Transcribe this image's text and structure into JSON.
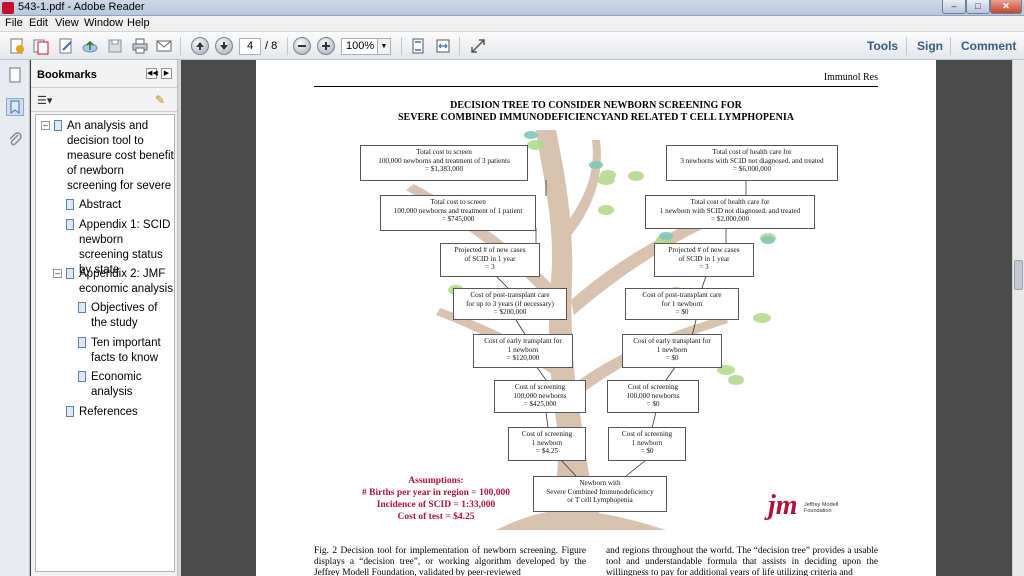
{
  "window": {
    "title": "543-1.pdf - Adobe Reader",
    "min_glyph": "–",
    "max_glyph": "□",
    "close_glyph": "✕"
  },
  "menu": [
    "File",
    "Edit",
    "View",
    "Window",
    "Help"
  ],
  "toolbar": {
    "page_number": "4",
    "page_total": "/ 8",
    "zoom": "100%",
    "tools_label": "Tools",
    "sign_label": "Sign",
    "comment_label": "Comment"
  },
  "bookmarks": {
    "title": "Bookmarks",
    "items": [
      {
        "label": "An analysis and decision tool to measure cost benefit of newborn screening for severe",
        "expanded": true
      },
      {
        "label": "Abstract"
      },
      {
        "label": "Appendix 1: SCID newborn screening status by state"
      },
      {
        "label": "Appendix 2: JMF economic analysis",
        "expanded": true
      },
      {
        "label": "Objectives of the study"
      },
      {
        "label": "Ten important facts to know"
      },
      {
        "label": "Economic analysis"
      },
      {
        "label": "References"
      }
    ]
  },
  "document": {
    "journal": "Immunol Res",
    "figure_title_1": "DECISION TREE TO CONSIDER NEWBORN SCREENING FOR",
    "figure_title_2": "SEVERE COMBINED IMMUNODEFICIENCYAND RELATED T CELL LYMPHOPENIA",
    "left_boxes": [
      "Total cost to screen\n100,000 newborns and treatment of 3 patients\n= $1,383,000",
      "Total cost to screen\n100,000 newborns and treatment of 1 patient\n= $745,000",
      "Projected # of new cases\nof SCID in 1 year\n= 3",
      "Cost of post-transplant care\nfor up to 3 years (if necessary)\n= $200,000",
      "Cost of early transplant for\n1 newborn\n= $120,000",
      "Cost of screening\n100,000 newborns\n= $425,000",
      "Cost of screening\n1 newborn\n= $4.25"
    ],
    "right_boxes": [
      "Total cost of  health care for\n3 newborns with SCID not diagnosed, and treated\n= $6,000,000",
      "Total cost of health care for\n1 newborn with SCID not diagnosed, and treated\n= $2,000,000",
      "Projected # of new cases\nof SCID in 1 year\n= 3",
      "Cost of post-transplant care\nfor 1 newborn\n= $0",
      "Cost of early transplant for\n1 newborn\n= $0",
      "Cost of screening\n100,000 newborns\n= $0",
      "Cost of screening\n1 newborn\n= $0"
    ],
    "root_box": "Newborn with\nSevere Combined Immunodeficiency\nor T cell Lymphopenia",
    "assumptions": {
      "heading": "Assumptions:",
      "line1": "# Births per year in region = 100,000",
      "line2": "Incidence of SCID = 1:33,000",
      "line3": "Cost of test = $4.25"
    },
    "logo_mark": "jm",
    "logo_text": "Jeffrey Modell\nFoundation",
    "caption_left": "Fig. 2 Decision tool for implementation of newborn screening. Figure displays a “decision tree”, or working algorithm developed by the Jeffrey Modell Foundation, validated by peer-reviewed",
    "caption_right": "and regions throughout the world. The “decision tree” provides a usable tool and understandable formula that assists in deciding upon the willingness to pay for additional years of life utilizing criteria and"
  }
}
